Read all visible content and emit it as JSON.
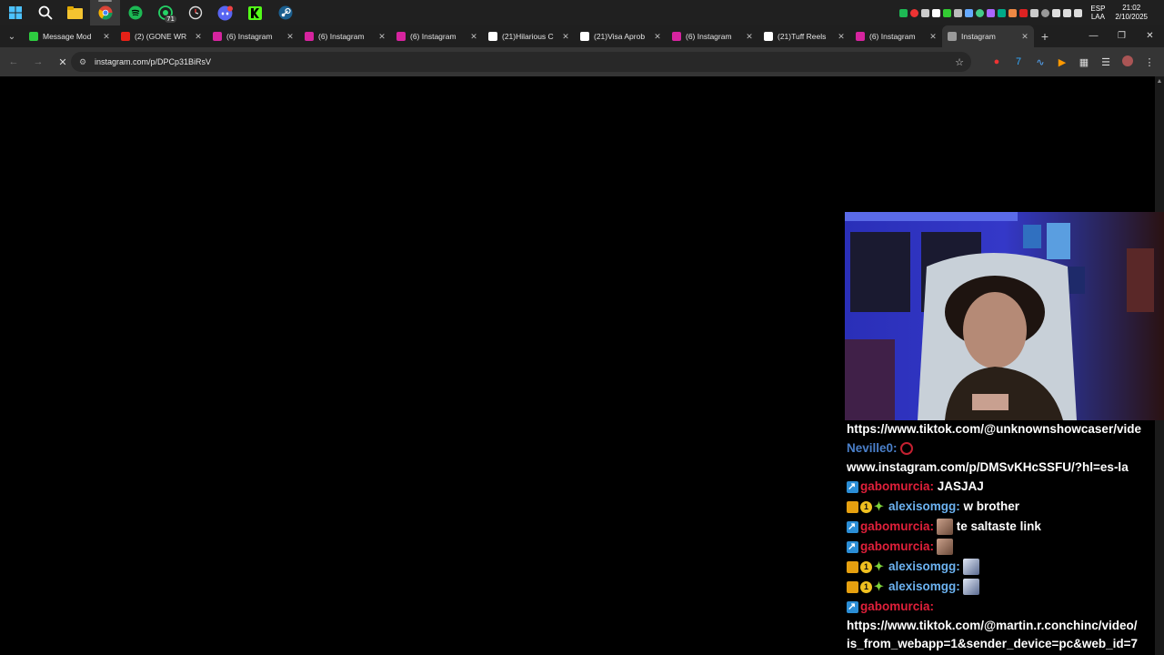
{
  "taskbar": {
    "apps": [
      {
        "icon": "windows-start-icon"
      },
      {
        "icon": "search-icon"
      },
      {
        "icon": "file-explorer-icon"
      },
      {
        "icon": "chrome-icon"
      },
      {
        "icon": "spotify-icon"
      },
      {
        "icon": "whatsapp-icon",
        "badge": "71"
      },
      {
        "icon": "clock-app-icon"
      },
      {
        "icon": "discord-icon"
      },
      {
        "icon": "kick-icon"
      },
      {
        "icon": "steam-icon"
      }
    ],
    "language": "ESP",
    "layout": "LAA",
    "time": "21:02",
    "date": "2/10/2025"
  },
  "tabs": [
    {
      "title": "Message Mod",
      "favicon": "#2ecc40"
    },
    {
      "title": "(2) (GONE WR",
      "favicon": "#e62117"
    },
    {
      "title": "(6) Instagram",
      "favicon": "#d6249f"
    },
    {
      "title": "(6) Instagram",
      "favicon": "#d6249f"
    },
    {
      "title": "(6) Instagram",
      "favicon": "#d6249f"
    },
    {
      "title": "(21)Hilarious C",
      "favicon": "#ffffff"
    },
    {
      "title": "(21)Visa Aprob",
      "favicon": "#ffffff"
    },
    {
      "title": "(6) Instagram",
      "favicon": "#d6249f"
    },
    {
      "title": "(21)Tuff Reels",
      "favicon": "#ffffff"
    },
    {
      "title": "(6) Instagram",
      "favicon": "#d6249f"
    },
    {
      "title": "Instagram",
      "favicon": "#9a9a9a",
      "active": true
    }
  ],
  "toolbar": {
    "url": "instagram.com/p/DPCp31BiRsV"
  },
  "chat": {
    "link_1": "https://www.tiktok.com/@unknownshowcaser/vide",
    "msg_1_user": "Neville0:",
    "link_2": "www.instagram.com/p/DMSvKHcSSFU/?hl=es-la",
    "msg_2_user": "gabomurcia:",
    "msg_2_text": "JASJAJ",
    "msg_3_user": "alexisomgg:",
    "msg_3_text": "w brother",
    "msg_4_user": "gabomurcia:",
    "msg_4_text": "te saltaste link",
    "msg_5_user": "gabomurcia:",
    "msg_6_user": "alexisomgg:",
    "msg_7_user": "alexisomgg:",
    "msg_8_user": "gabomurcia:",
    "link_3": "https://www.tiktok.com/@martin.r.conchinc/video/",
    "link_4": "is_from_webapp=1&sender_device=pc&web_id=7"
  }
}
